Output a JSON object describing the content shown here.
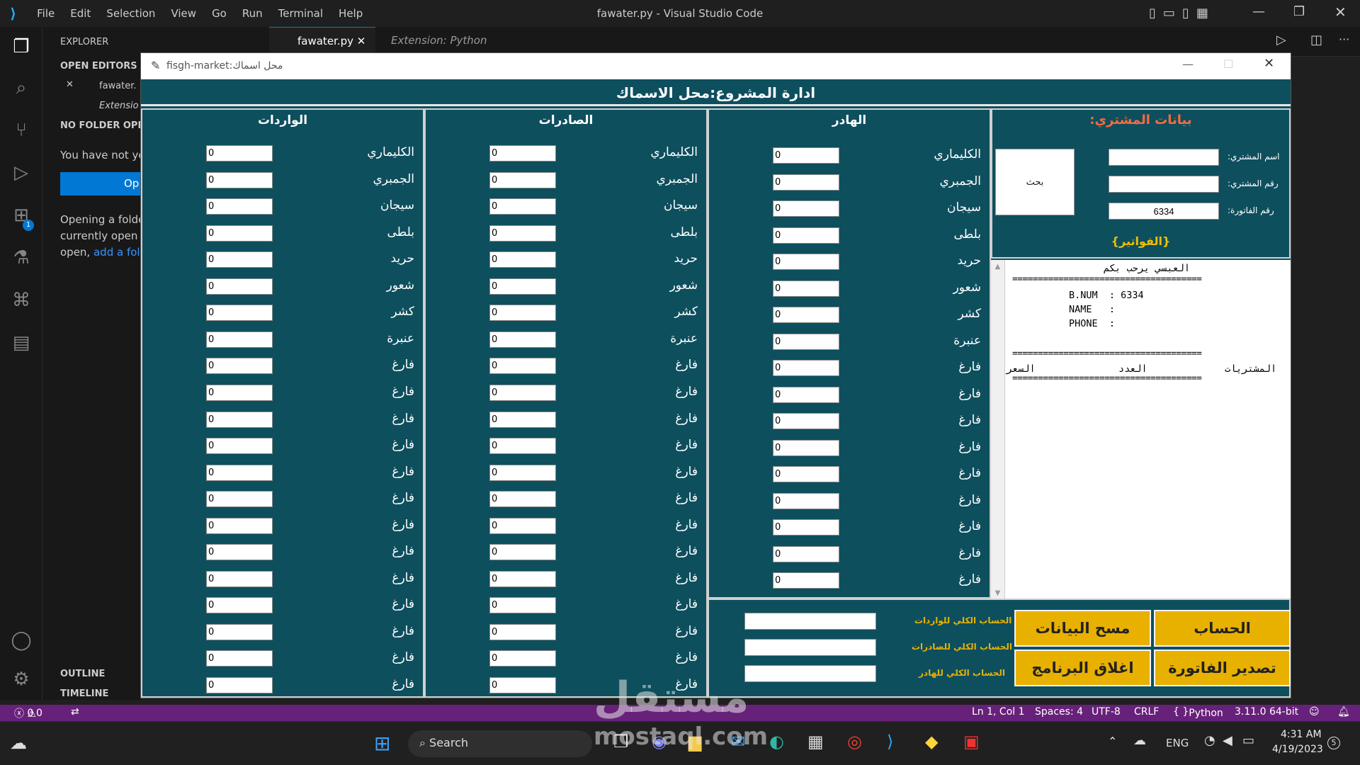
{
  "vscode": {
    "menu": [
      "File",
      "Edit",
      "Selection",
      "View",
      "Go",
      "Run",
      "Terminal",
      "Help"
    ],
    "window_title": "fawater.py - Visual Studio Code",
    "sidebar": {
      "explorer": "EXPLORER",
      "open_editors": "OPEN EDITORS",
      "open_editor_file": "fawater.",
      "open_editor_ext": "Extensio",
      "no_folder": "NO FOLDER OPEN",
      "no_folder_text": "You have not ye",
      "open_button": "Op",
      "opening_1": "Opening a folde",
      "opening_2": "currently open e",
      "opening_3": "open, ",
      "add_folder_link": "add a fold",
      "outline": "OUTLINE",
      "timeline": "TIMELINE"
    },
    "tabs": [
      {
        "label": "fawater.py",
        "active": true
      },
      {
        "label": "Extension: Python",
        "active": false
      }
    ],
    "badge_count": "1",
    "status": {
      "errors": "0",
      "warnings": "0",
      "position": "Ln 1, Col 1",
      "spaces": "Spaces: 4",
      "encoding": "UTF-8",
      "eol": "CRLF",
      "language": "Python",
      "interpreter": "3.11.0 64-bit"
    }
  },
  "app": {
    "window_title": "fisgh-market:محل اسماك",
    "header": "ادارة المشروع:محل الاسماك",
    "panels": [
      {
        "title": "الهادر",
        "items": [
          "الكليماري",
          "الجمبري",
          "سيجان",
          "بلطى",
          "حريد",
          "شعور",
          "كشر",
          "عنبرة",
          "فارغ",
          "فارغ",
          "فارغ",
          "فارغ",
          "فارغ",
          "فارغ",
          "فارغ",
          "فارغ",
          "فارغ"
        ]
      },
      {
        "title": "الصادرات",
        "items": [
          "الكليماري",
          "الجمبري",
          "سيجان",
          "بلطى",
          "حريد",
          "شعور",
          "كشر",
          "عنبرة",
          "فارغ",
          "فارغ",
          "فارغ",
          "فارغ",
          "فارغ",
          "فارغ",
          "فارغ",
          "فارغ",
          "فارغ",
          "فارغ",
          "فارغ",
          "فارغ",
          "فارغ"
        ]
      },
      {
        "title": "الواردات",
        "items": [
          "الكليماري",
          "الجمبري",
          "سيجان",
          "بلطى",
          "حريد",
          "شعور",
          "كشر",
          "عنبرة",
          "فارغ",
          "فارغ",
          "فارغ",
          "فارغ",
          "فارغ",
          "فارغ",
          "فارغ",
          "فارغ",
          "فارغ",
          "فارغ",
          "فارغ",
          "فارغ",
          "فارغ"
        ]
      }
    ],
    "default_value": "0",
    "customer": {
      "title": "بيانات المشتري:",
      "name_label": "اسم المشتري:",
      "phone_label": "رقم المشتري:",
      "invoice_label": "رقم الفاتورة:",
      "invoice_value": "6334",
      "search_button": "بحث",
      "invoices_title": "{الفواتير}"
    },
    "bill": {
      "welcome": "العبسي يرحب بكم",
      "divider": "=====================================",
      "bnum": "B.NUM  : 6334",
      "name": "NAME   :",
      "phone": "PHONE  :",
      "col_items": "المشتريات",
      "col_count": "العدد",
      "col_price": "السعر"
    },
    "totals": {
      "imports": "الحساب الكلي للواردات",
      "exports": "الحساب الكلي للصادرات",
      "waste": "الحساب الكلي للهادر"
    },
    "buttons": {
      "calculate": "الحساب",
      "clear": "مسح البيانات",
      "export_invoice": "تصدير الفاتورة",
      "close": "اغلاق البرنامج"
    }
  },
  "taskbar": {
    "search": "Search",
    "lang": "ENG",
    "time": "4:31 AM",
    "date": "4/19/2023",
    "notif": "5"
  },
  "watermark": "mostaql.com"
}
